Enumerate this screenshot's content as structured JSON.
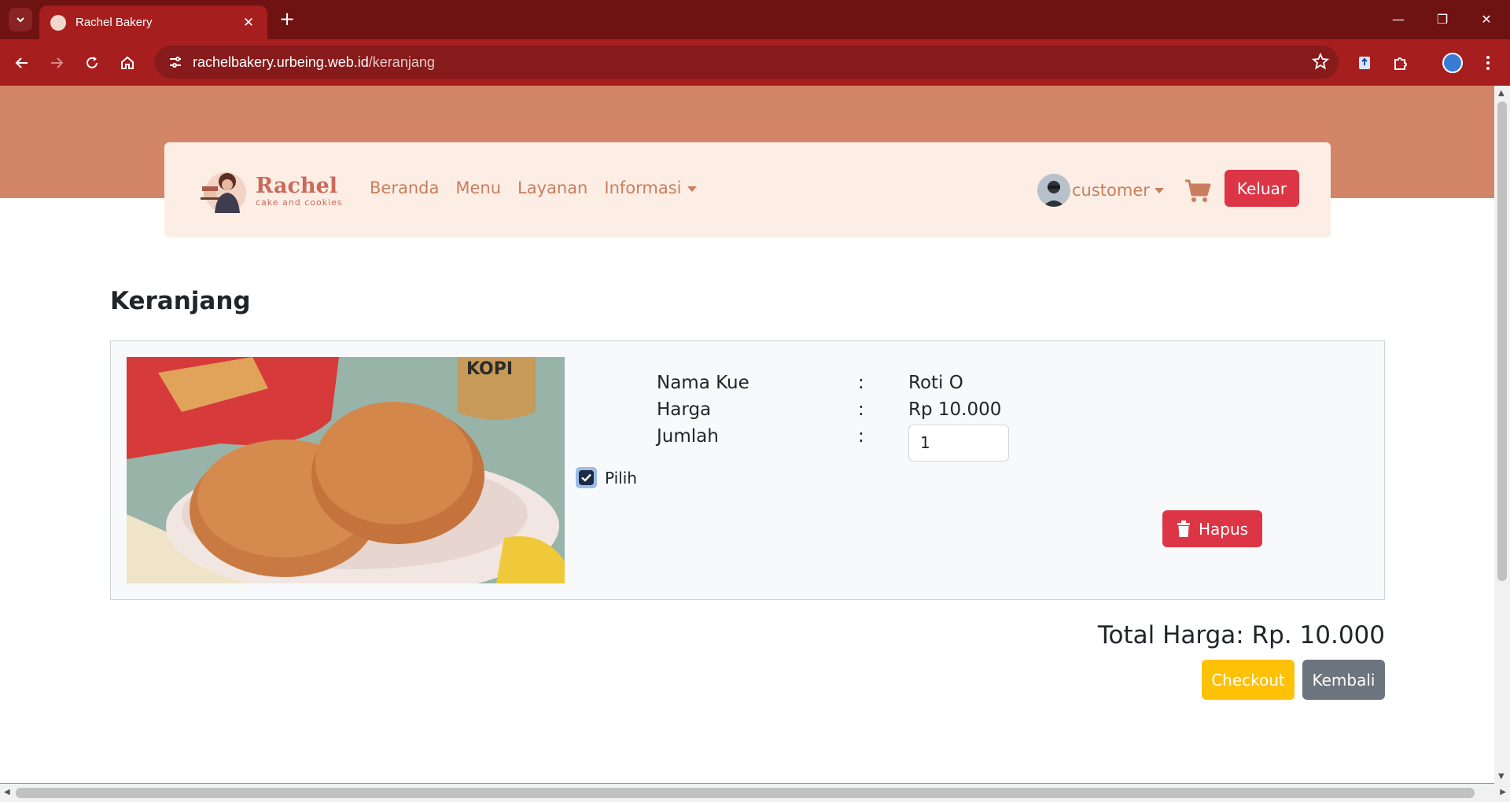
{
  "browser": {
    "tab_title": "Rachel Bakery",
    "url_host": "rachelbakery.urbeing.web.id",
    "url_path": "/keranjang"
  },
  "site": {
    "logo_name": "Rachel",
    "logo_tagline": "cake and cookies",
    "nav": [
      "Beranda",
      "Menu",
      "Layanan",
      "Informasi"
    ],
    "username": "customer",
    "logout_label": "Keluar"
  },
  "page": {
    "title": "Keranjang"
  },
  "cart_item": {
    "select_label": "Pilih",
    "selected": true,
    "name_label": "Nama Kue",
    "name_value": "Roti O",
    "price_label": "Harga",
    "price_value": "Rp 10.000",
    "qty_label": "Jumlah",
    "qty_value": "1",
    "colon": ":",
    "delete_label": "Hapus"
  },
  "summary": {
    "total_text": "Total Harga: Rp. 10.000",
    "checkout_label": "Checkout",
    "back_label": "Kembali"
  },
  "colors": {
    "browser_frame": "#a61e1e",
    "brand": "#d38568",
    "danger": "#dc3545",
    "warning": "#ffc107",
    "secondary": "#6c757d"
  }
}
